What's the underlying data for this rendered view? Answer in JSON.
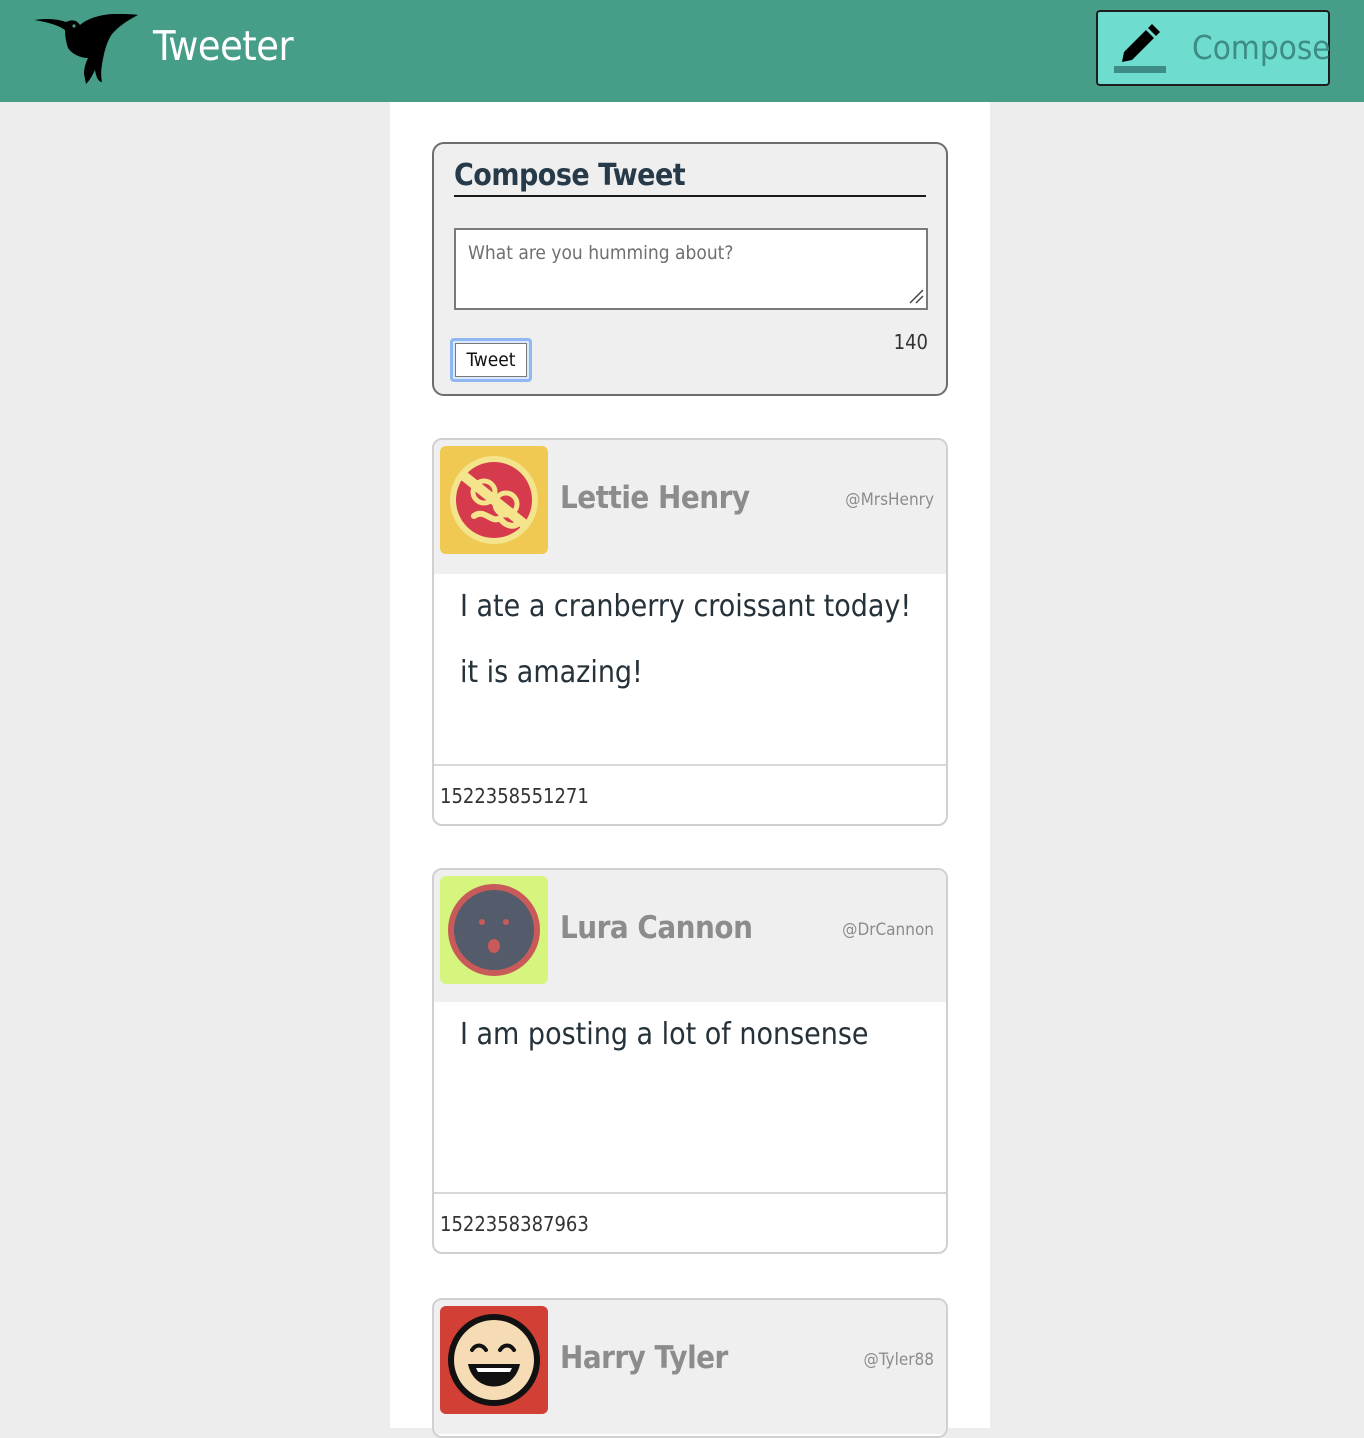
{
  "nav": {
    "brand": "Tweeter",
    "compose_label": "Compose",
    "color": "#469e89",
    "compose_color": "#6fdcd0"
  },
  "composer": {
    "title": "Compose Tweet",
    "placeholder": "What are you humming about?",
    "submit_label": "Tweet",
    "counter": "140"
  },
  "tweets": [
    {
      "name": "Lettie Henry",
      "handle": "@MrsHenry",
      "text": "I ate a cranberry croissant today! it is amazing!",
      "timestamp": "1522358551271",
      "avatar_icon": "mustache-glasses-avatar-icon",
      "avatar_bg": "#efc951"
    },
    {
      "name": "Lura Cannon",
      "handle": "@DrCannon",
      "text": "I am posting a lot of nonsense",
      "timestamp": "1522358387963",
      "avatar_icon": "surprised-face-avatar-icon",
      "avatar_bg": "#d5f57f"
    },
    {
      "name": "Harry Tyler",
      "handle": "@Tyler88",
      "avatar_icon": "laughing-face-avatar-icon",
      "avatar_bg": "#d23f35"
    }
  ]
}
